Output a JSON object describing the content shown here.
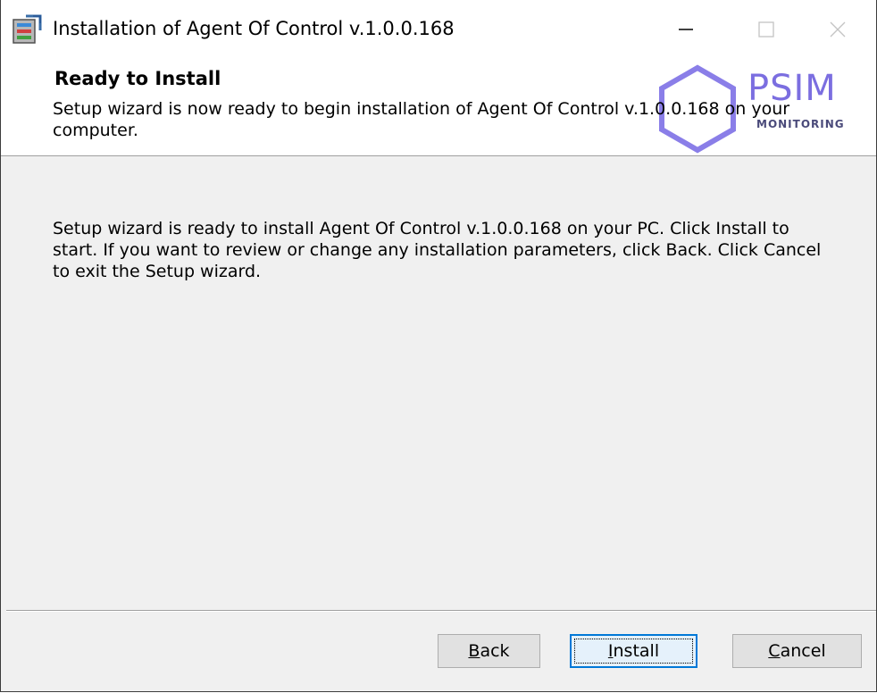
{
  "window": {
    "title": "Installation of Agent Of Control v.1.0.0.168",
    "controls": {
      "minimize_icon": "minimize-icon",
      "maximize_icon": "maximize-icon",
      "close_icon": "close-icon"
    }
  },
  "header": {
    "title": "Ready to Install",
    "description": "Setup wizard is now ready to begin installation of Agent Of Control v.1.0.0.168 on your computer.",
    "logo": {
      "name": "PSIM",
      "tagline": "MONITORING",
      "color": "#7b6ee0"
    }
  },
  "body": {
    "text": "Setup wizard is ready to install Agent Of Control v.1.0.0.168 on your PC. Click Install to start. If you want to review or change any installation parameters, click Back. Click Cancel to exit the Setup wizard."
  },
  "buttons": {
    "back": {
      "mnemonic": "B",
      "rest": "ack"
    },
    "install": {
      "mnemonic": "I",
      "rest": "nstall"
    },
    "cancel": {
      "mnemonic": "C",
      "rest": "ancel"
    }
  },
  "colors": {
    "accent": "#0078d7",
    "face": "#f0f0f0"
  }
}
